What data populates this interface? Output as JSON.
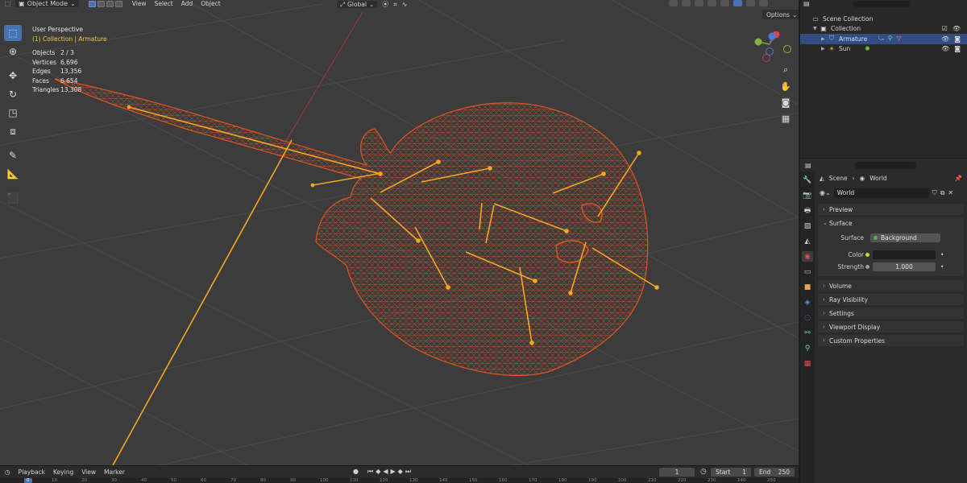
{
  "viewport": {
    "header": {
      "mode": "Object Mode",
      "menus": [
        "View",
        "Select",
        "Add",
        "Object"
      ],
      "transform_orientation": "Global",
      "options_label": "Options"
    },
    "overlay": {
      "perspective": "User Perspective",
      "collection": "(1) Collection | Armature"
    },
    "stats": [
      {
        "label": "Objects",
        "value": "2 / 3"
      },
      {
        "label": "Vertices",
        "value": "6,696"
      },
      {
        "label": "Edges",
        "value": "13,356"
      },
      {
        "label": "Faces",
        "value": "6,654"
      },
      {
        "label": "Triangles",
        "value": "13,308"
      }
    ],
    "colors": {
      "wire": "#e0541f",
      "bone": "#f5a623",
      "background": "#3c3c3c"
    }
  },
  "timeline": {
    "menus": [
      "Playback",
      "Keying",
      "View",
      "Marker"
    ],
    "current_frame": "1",
    "start_label": "Start",
    "start": "1",
    "end_label": "End",
    "end": "250",
    "ruler": [
      "0",
      "10",
      "20",
      "30",
      "40",
      "50",
      "60",
      "70",
      "80",
      "90",
      "100",
      "110",
      "120",
      "130",
      "140",
      "150",
      "160",
      "170",
      "180",
      "190",
      "200",
      "210",
      "220",
      "230",
      "240",
      "250"
    ]
  },
  "outliner": {
    "scene_collection": "Scene Collection",
    "collection": "Collection",
    "items": [
      {
        "name": "Armature",
        "selected": true
      },
      {
        "name": "Sun",
        "selected": false
      }
    ]
  },
  "properties": {
    "breadcrumb": {
      "scene": "Scene",
      "world": "World"
    },
    "world_name": "World",
    "panels": {
      "preview": "Preview",
      "surface": "Surface",
      "volume": "Volume",
      "ray_visibility": "Ray Visibility",
      "settings": "Settings",
      "viewport_display": "Viewport Display",
      "custom_properties": "Custom Properties"
    },
    "surface": {
      "surface_label": "Surface",
      "surface_value": "Background",
      "color_label": "Color",
      "strength_label": "Strength",
      "strength_value": "1.000"
    }
  }
}
